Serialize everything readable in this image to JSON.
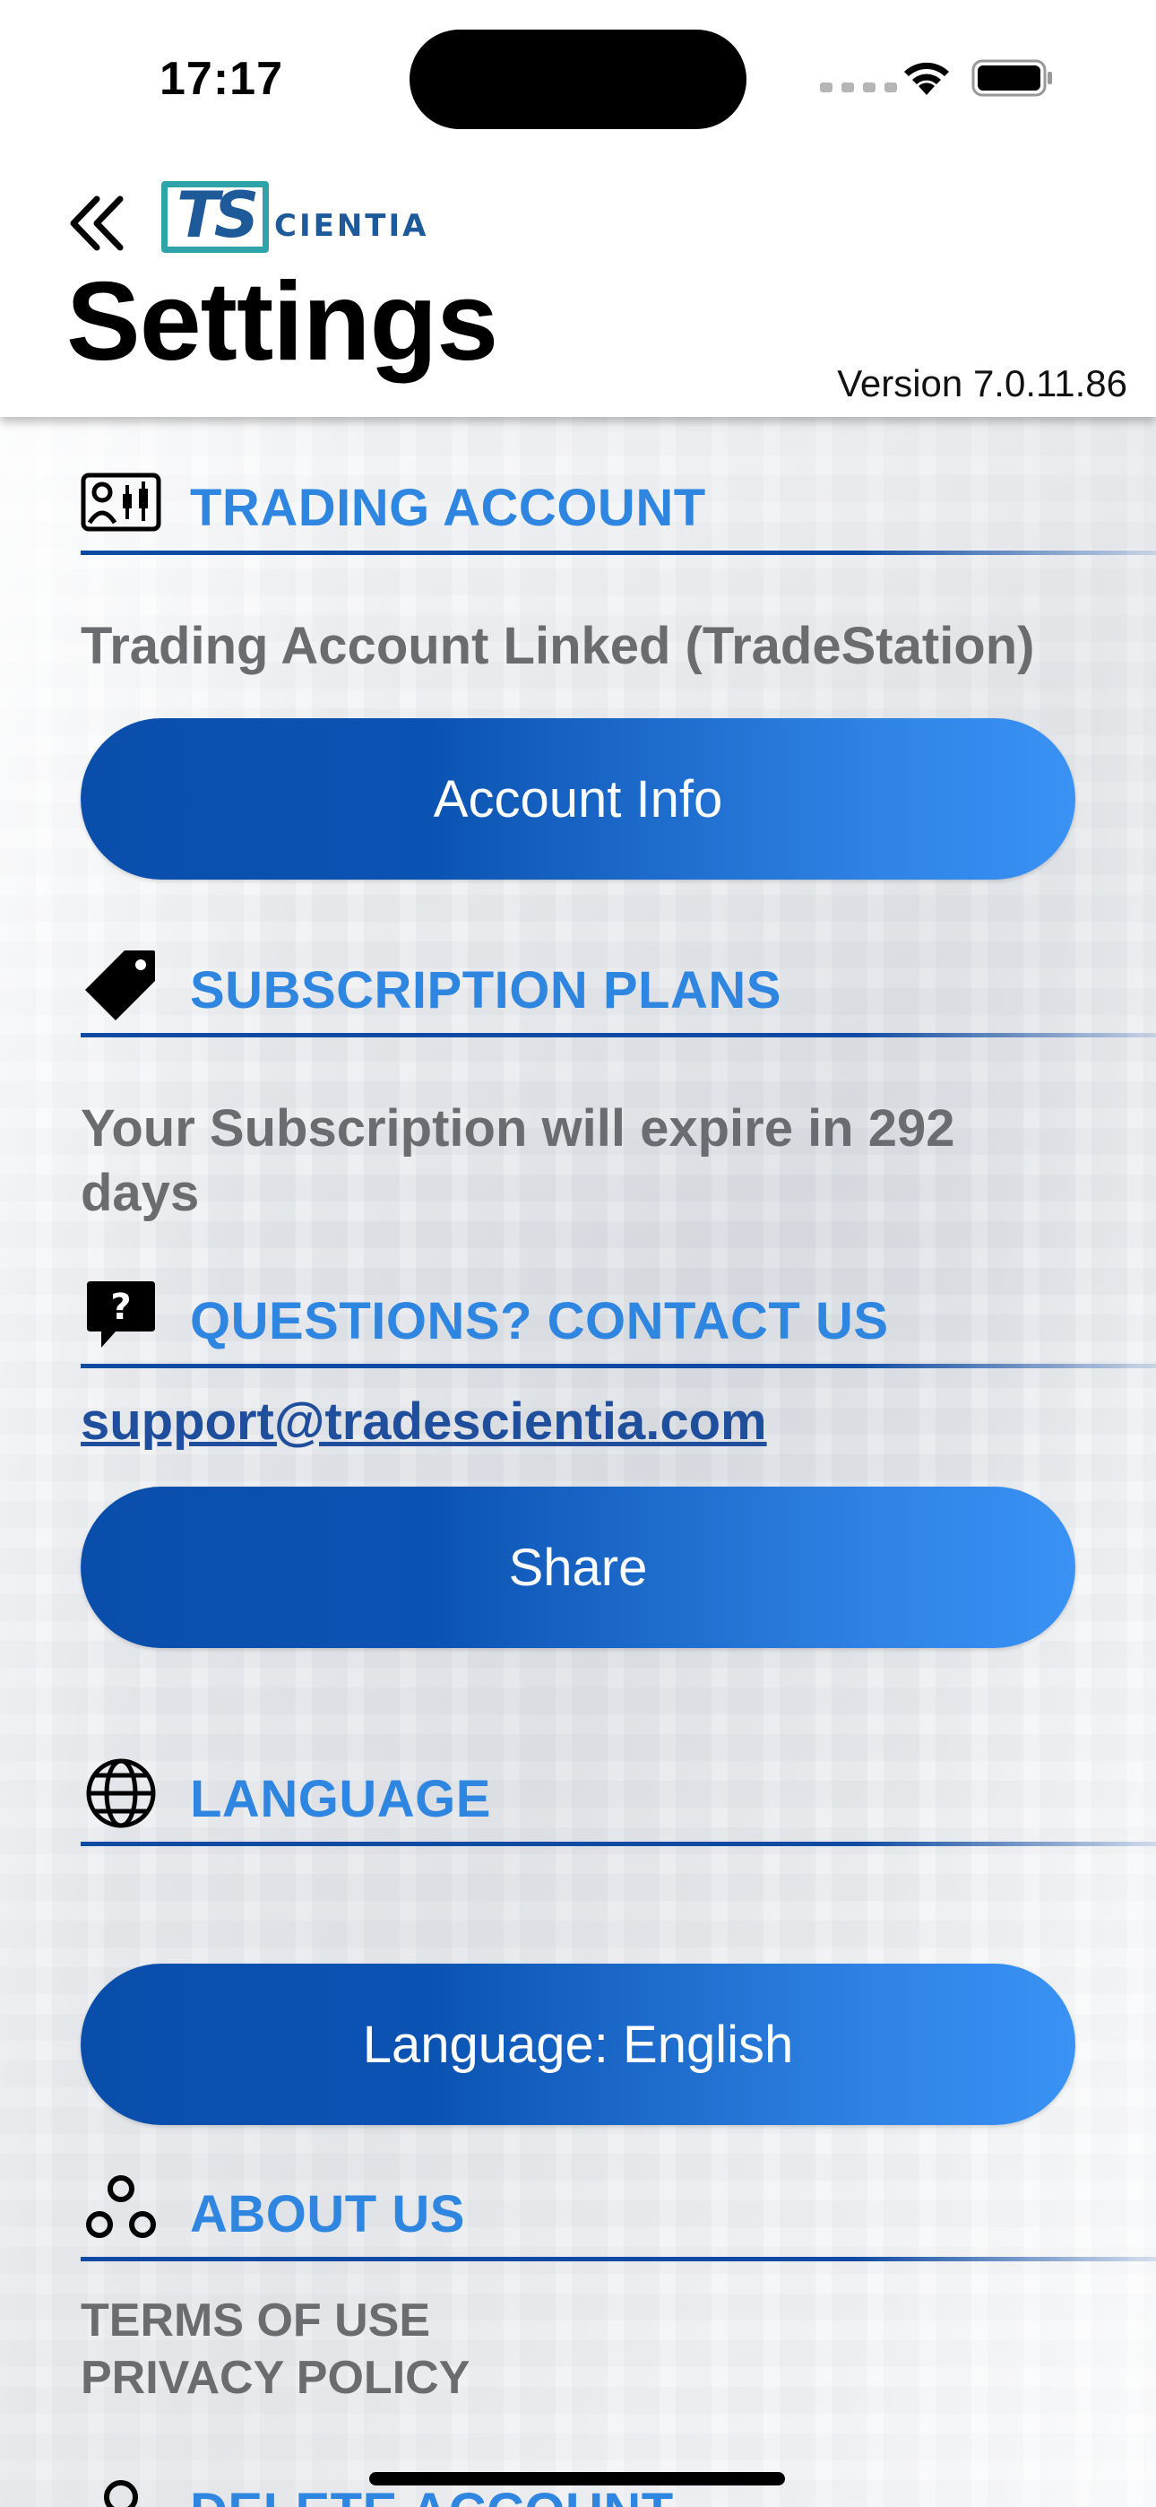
{
  "status_bar": {
    "time": "17:17"
  },
  "header": {
    "logo_mark": "TS",
    "logo_text": "CIENTIA",
    "title": "Settings",
    "version": "Version 7.0.11.86"
  },
  "sections": {
    "trading": {
      "title": "TRADING ACCOUNT",
      "status": "Trading Account Linked (TradeStation)",
      "button": "Account Info"
    },
    "subscription": {
      "title": "SUBSCRIPTION PLANS",
      "status": "Your Subscription will expire in 292 days"
    },
    "contact": {
      "title": "QUESTIONS? CONTACT US",
      "email": "support@tradescientia.com",
      "button": "Share"
    },
    "language": {
      "title": "LANGUAGE",
      "button": "Language: English"
    },
    "about": {
      "title": "ABOUT US",
      "terms": "TERMS OF USE",
      "privacy": "PRIVACY POLICY"
    },
    "delete": {
      "title": "DELETE ACCOUNT"
    }
  },
  "colors": {
    "accent": "#2f86e0",
    "divider": "#0d4aa3",
    "button_start": "#0a4eab",
    "button_end": "#3a92f5",
    "muted_text": "#6a6c70"
  }
}
